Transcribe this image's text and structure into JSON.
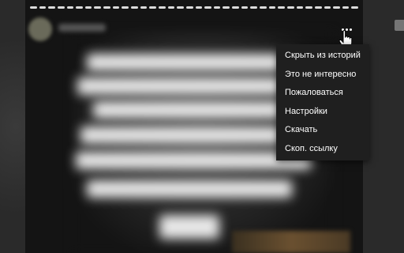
{
  "story": {
    "progress_segments": 36
  },
  "menu": {
    "more_icon": "more-horizontal-icon",
    "items": [
      {
        "label": "Скрыть из историй"
      },
      {
        "label": "Это не интересно"
      },
      {
        "label": "Пожаловаться"
      },
      {
        "label": "Настройки"
      },
      {
        "label": "Скачать"
      },
      {
        "label": "Скоп. ссылку"
      }
    ]
  },
  "colors": {
    "menu_background": "#1f1f1f",
    "menu_text": "#ffffff",
    "story_background": "#141414"
  }
}
